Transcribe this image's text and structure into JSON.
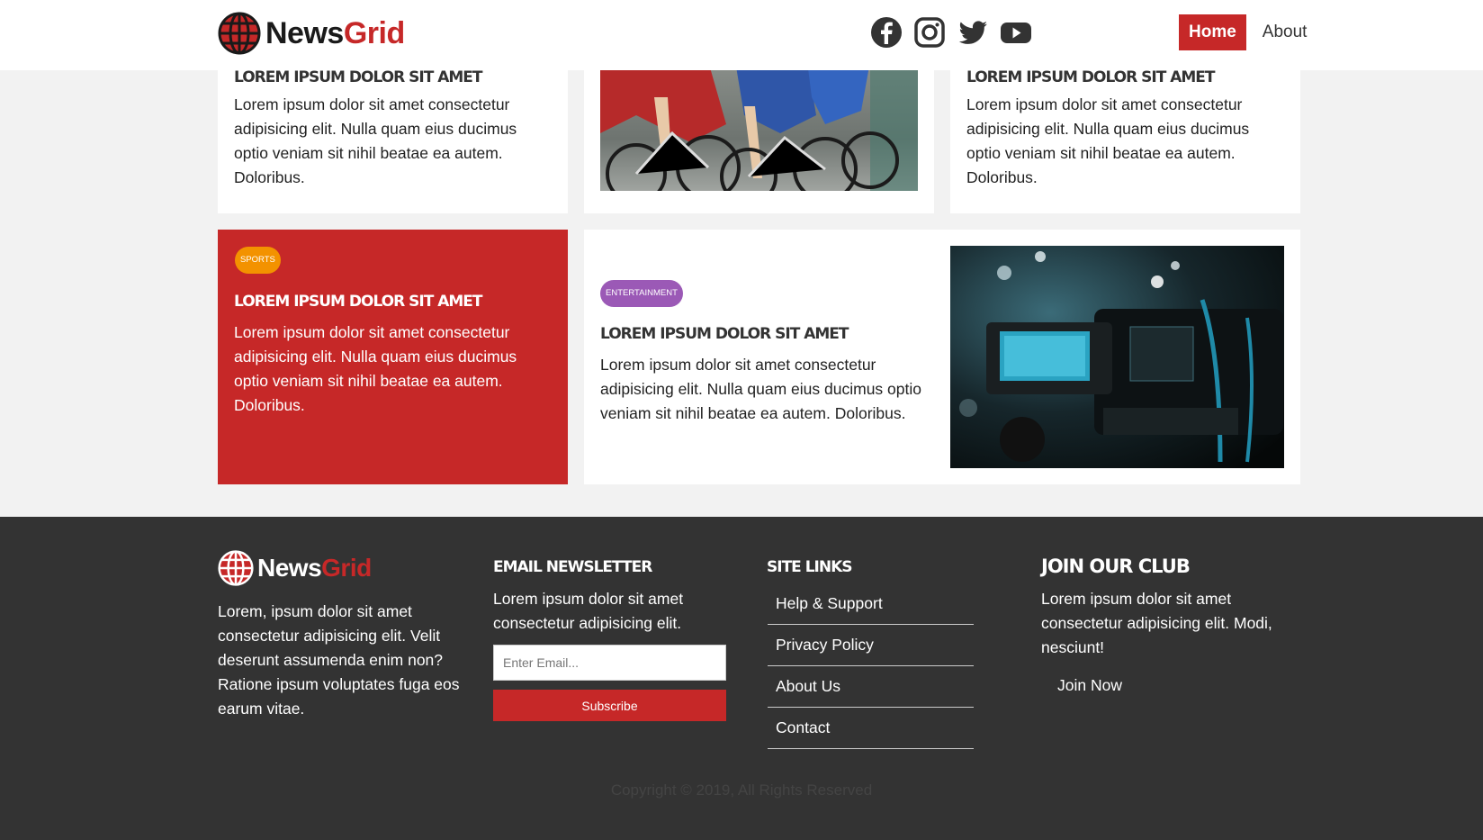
{
  "brand": {
    "news": "News",
    "grid": "Grid"
  },
  "colors": {
    "brand_red": "#c62828",
    "footer_bg": "#333333",
    "sports_badge": "#f39200",
    "entertainment_badge": "#9b59b6"
  },
  "nav": {
    "social": [
      {
        "name": "facebook-icon"
      },
      {
        "name": "instagram-icon"
      },
      {
        "name": "twitter-icon"
      },
      {
        "name": "youtube-icon"
      }
    ],
    "links": [
      {
        "label": "Home",
        "active": true
      },
      {
        "label": "About",
        "active": false
      }
    ]
  },
  "cards": {
    "top_left": {
      "title": "Lorem ipsum dolor sit amet",
      "text": "Lorem ipsum dolor sit amet consectetur adipisicing elit. Nulla quam eius ducimus optio veniam sit nihil beatae ea autem. Doloribus."
    },
    "top_middle": {
      "image": "cycling-race-photo"
    },
    "top_right": {
      "title": "Lorem ipsum dolor sit amet",
      "text": "Lorem ipsum dolor sit amet consectetur adipisicing elit. Nulla quam eius ducimus optio veniam sit nihil beatae ea autem. Doloribus."
    },
    "sports": {
      "badge": "Sports",
      "title": "Lorem ipsum dolor sit amet",
      "text": "Lorem ipsum dolor sit amet consectetur adipisicing elit. Nulla quam eius ducimus optio veniam sit nihil beatae ea autem. Doloribus."
    },
    "entertainment": {
      "badge": "Entertainment",
      "title": "Lorem ipsum dolor sit amet",
      "text": "Lorem ipsum dolor sit amet consectetur adipisicing elit. Nulla quam eius ducimus optio veniam sit nihil beatae ea autem. Doloribus.",
      "image": "video-camera-photo"
    }
  },
  "footer": {
    "about": "Lorem, ipsum dolor sit amet consectetur adipisicing elit. Velit deserunt assumenda enim non? Ratione ipsum voluptates fuga eos earum vitae.",
    "newsletter": {
      "heading": "Email Newsletter",
      "text": "Lorem ipsum dolor sit amet consectetur adipisicing elit.",
      "placeholder": "Enter Email...",
      "button": "Subscribe"
    },
    "site_links": {
      "heading": "Site Links",
      "items": [
        "Help & Support",
        "Privacy Policy",
        "About Us",
        "Contact"
      ]
    },
    "club": {
      "heading": "Join Our Club",
      "text": "Lorem ipsum dolor sit amet consectetur adipisicing elit. Modi, nesciunt!",
      "button": "Join Now"
    },
    "copyright": "Copyright © 2019, All Rights Reserved"
  }
}
